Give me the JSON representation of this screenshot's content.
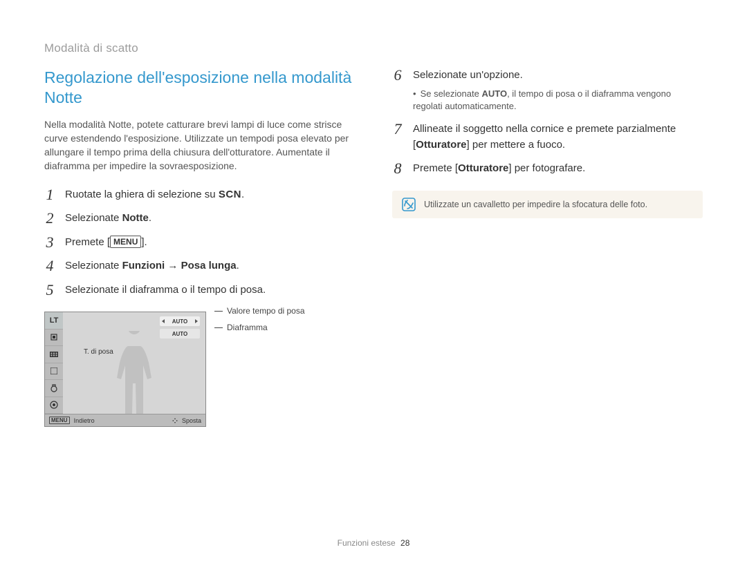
{
  "breadcrumb": "Modalità di scatto",
  "heading": "Regolazione dell'esposizione nella modalità Notte",
  "intro": "Nella modalità Notte, potete catturare brevi lampi di luce come strisce curve estendendo l'esposizione. Utilizzate un tempodi posa elevato per allungare il tempo prima della chiusura dell'otturatore. Aumentate il diaframma per impedire la sovraesposizione.",
  "steps_left": [
    {
      "n": "1",
      "text_before": "Ruotate la ghiera di selezione su ",
      "scn": "SCN",
      "text_after": "."
    },
    {
      "n": "2",
      "text_before": "Selezionate ",
      "bold": "Notte",
      "text_after": "."
    },
    {
      "n": "3",
      "text_before": "Premete [",
      "menu": "MENU",
      "text_after": "]."
    },
    {
      "n": "4",
      "text_before": "Selezionate ",
      "bold": "Funzioni",
      "arrow": " → ",
      "bold2": "Posa lunga",
      "text_after": "."
    },
    {
      "n": "5",
      "text_before": "Selezionate il diaframma o il tempo di posa."
    }
  ],
  "camera": {
    "lt": "LT",
    "pill_auto": "AUTO",
    "pill_auto2": "AUTO",
    "label": "T. di posa",
    "footer_menu": "MENU",
    "footer_back": "Indietro",
    "footer_move": "Sposta"
  },
  "callouts": {
    "c1": "Valore tempo di posa",
    "c2": "Diaframma"
  },
  "steps_right": [
    {
      "n": "6",
      "text_before": "Selezionate un'opzione.",
      "sub_before": "Se selezionate ",
      "sub_bold": "AUTO",
      "sub_after": ", il tempo di posa o il diaframma vengono regolati automaticamente."
    },
    {
      "n": "7",
      "text_before": "Allineate il soggetto nella cornice e premete parzialmente [",
      "bold": "Otturatore",
      "text_after": "] per mettere a fuoco."
    },
    {
      "n": "8",
      "text_before": "Premete [",
      "bold": "Otturatore",
      "text_after": "] per fotografare."
    }
  ],
  "note": "Utilizzate un cavalletto per impedire la sfocatura delle foto.",
  "footer": {
    "section": "Funzioni estese",
    "page": "28"
  }
}
